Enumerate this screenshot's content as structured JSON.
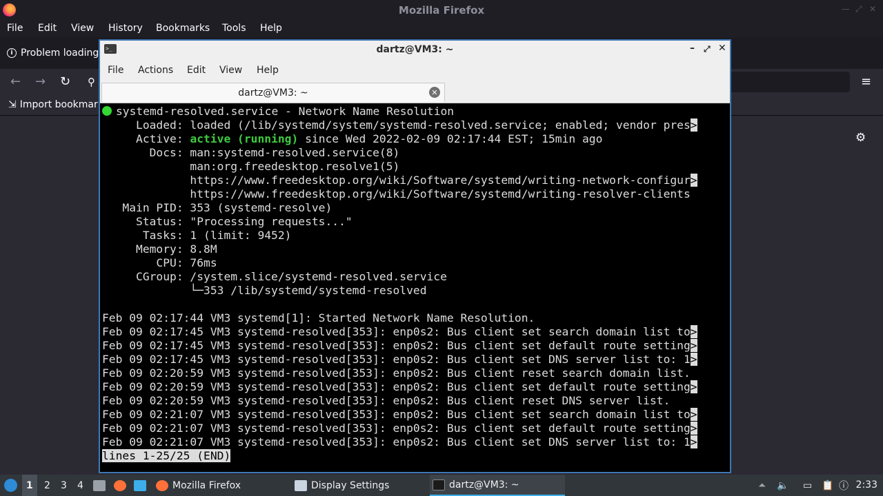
{
  "firefox": {
    "window_title": "Mozilla Firefox",
    "menu": [
      "File",
      "Edit",
      "View",
      "History",
      "Bookmarks",
      "Tools",
      "Help"
    ],
    "tab_title": "Problem loading",
    "bookmark_item": "Import bookmark"
  },
  "terminal": {
    "window_title": "dartz@VM3: ~",
    "menu": [
      "File",
      "Actions",
      "Edit",
      "View",
      "Help"
    ],
    "tab_title": "dartz@VM3: ~",
    "lines": [
      " systemd-resolved.service - Network Name Resolution",
      "     Loaded: loaded (/lib/systemd/system/systemd-resolved.service; enabled; vendor pres",
      "     Active: ",
      "       Docs: man:systemd-resolved.service(8)",
      "             man:org.freedesktop.resolve1(5)",
      "             https://www.freedesktop.org/wiki/Software/systemd/writing-network-configur",
      "             https://www.freedesktop.org/wiki/Software/systemd/writing-resolver-clients",
      "   Main PID: 353 (systemd-resolve)",
      "     Status: \"Processing requests...\"",
      "      Tasks: 1 (limit: 9452)",
      "     Memory: 8.8M",
      "        CPU: 76ms",
      "     CGroup: /system.slice/systemd-resolved.service",
      "             └─353 /lib/systemd/systemd-resolved",
      "",
      "Feb 09 02:17:44 VM3 systemd[1]: Started Network Name Resolution.",
      "Feb 09 02:17:45 VM3 systemd-resolved[353]: enp0s2: Bus client set search domain list to",
      "Feb 09 02:17:45 VM3 systemd-resolved[353]: enp0s2: Bus client set default route setting",
      "Feb 09 02:17:45 VM3 systemd-resolved[353]: enp0s2: Bus client set DNS server list to: 1",
      "Feb 09 02:20:59 VM3 systemd-resolved[353]: enp0s2: Bus client reset search domain list.",
      "Feb 09 02:20:59 VM3 systemd-resolved[353]: enp0s2: Bus client set default route setting",
      "Feb 09 02:20:59 VM3 systemd-resolved[353]: enp0s2: Bus client reset DNS server list.",
      "Feb 09 02:21:07 VM3 systemd-resolved[353]: enp0s2: Bus client set search domain list to",
      "Feb 09 02:21:07 VM3 systemd-resolved[353]: enp0s2: Bus client set default route setting",
      "Feb 09 02:21:07 VM3 systemd-resolved[353]: enp0s2: Bus client set DNS server list to: 1"
    ],
    "active_state": "active (running)",
    "active_rest": " since Wed 2022-02-09 02:17:44 EST; 15min ago",
    "truncated_line_indexes": [
      1,
      5,
      16,
      17,
      18,
      20,
      22,
      23,
      24
    ],
    "truncation_marker": ">",
    "status_line": "lines 1-25/25 (END)"
  },
  "taskbar": {
    "workspaces": [
      "1",
      "2",
      "3",
      "4"
    ],
    "active_workspace": "1",
    "tasks": [
      "Mozilla Firefox",
      "Display Settings",
      "dartz@VM3: ~"
    ],
    "active_task": "dartz@VM3: ~",
    "clock": "2:33"
  }
}
